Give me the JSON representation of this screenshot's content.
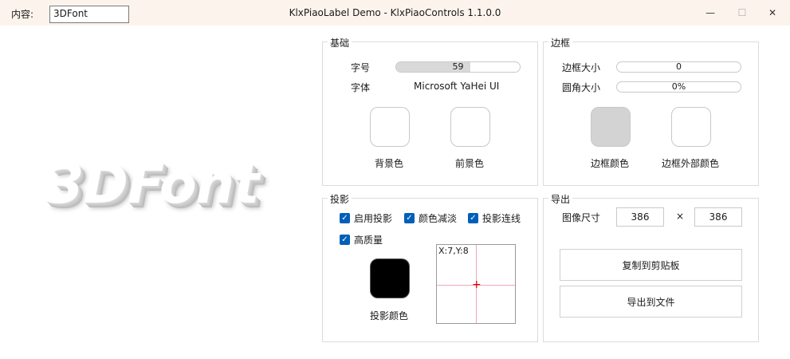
{
  "titlebar": {
    "content_label": "内容:",
    "content_value": "3DFont",
    "title": "KlxPiaoLabel Demo - KlxPiaoControls 1.1.0.0",
    "min_glyph": "—",
    "max_glyph": "☐",
    "close_glyph": "✕"
  },
  "preview": {
    "text": "3DFont"
  },
  "basic": {
    "title": "基础",
    "font_size_label": "字号",
    "font_size_value": "59",
    "font_size_fraction": 0.6,
    "font_label": "字体",
    "font_value": "Microsoft YaHei UI",
    "bg_color_label": "背景色",
    "fg_color_label": "前景色",
    "bg_color": "#ffffff",
    "fg_color": "#ffffff"
  },
  "border": {
    "title": "边框",
    "size_label": "边框大小",
    "size_value": "0",
    "radius_label": "圆角大小",
    "radius_value": "0%",
    "color_label": "边框颜色",
    "outer_color_label": "边框外部颜色",
    "color": "#d3d3d3",
    "outer_color": "#ffffff"
  },
  "shadow": {
    "title": "投影",
    "checkboxes": [
      {
        "label": "启用投影",
        "checked": true
      },
      {
        "label": "颜色减淡",
        "checked": true
      },
      {
        "label": "投影连线",
        "checked": true
      },
      {
        "label": "高质量",
        "checked": true
      }
    ],
    "color_label": "投影颜色",
    "color": "#000000",
    "picker_coord": "X:7,Y:8"
  },
  "export": {
    "title": "导出",
    "size_label": "图像尺寸",
    "width": "386",
    "times": "×",
    "height": "386",
    "copy_button": "复制到剪贴板",
    "file_button": "导出到文件"
  }
}
